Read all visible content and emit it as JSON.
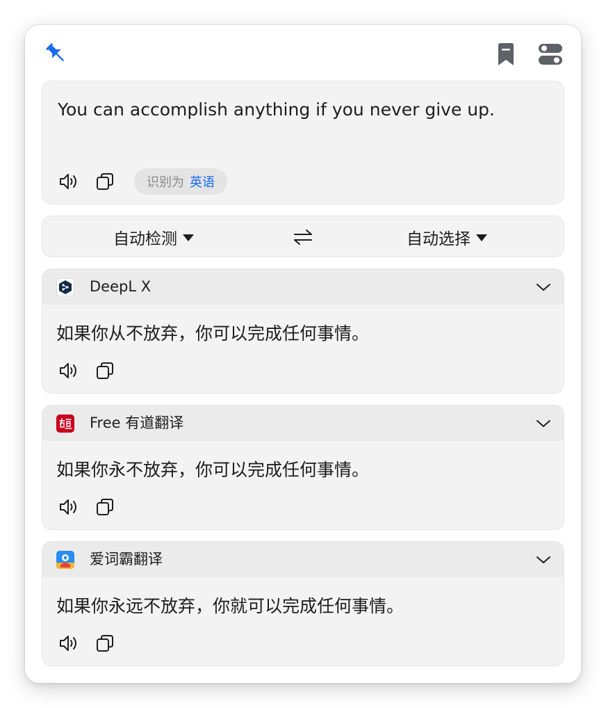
{
  "input": {
    "text": "You can accomplish anything if you never give up.",
    "detected_prefix": "识别为",
    "detected_language": "英语"
  },
  "languages": {
    "from": "自动检测",
    "to": "自动选择"
  },
  "results": [
    {
      "service": "DeepL X",
      "text": "如果你从不放弃，你可以完成任何事情。",
      "logo": "deepl-logo-icon"
    },
    {
      "service": "Free 有道翻译",
      "text": "如果你永不放弃，你可以完成任何事情。",
      "logo": "youdao-logo-icon"
    },
    {
      "service": "爱词霸翻译",
      "text": "如果你永远不放弃，你就可以完成任何事情。",
      "logo": "iciba-logo-icon"
    }
  ],
  "colors": {
    "accent": "#1a6bf0",
    "youdao_red": "#c8001e",
    "deepl_dark": "#0f2b46",
    "iciba_blue": "#2a8df0"
  }
}
